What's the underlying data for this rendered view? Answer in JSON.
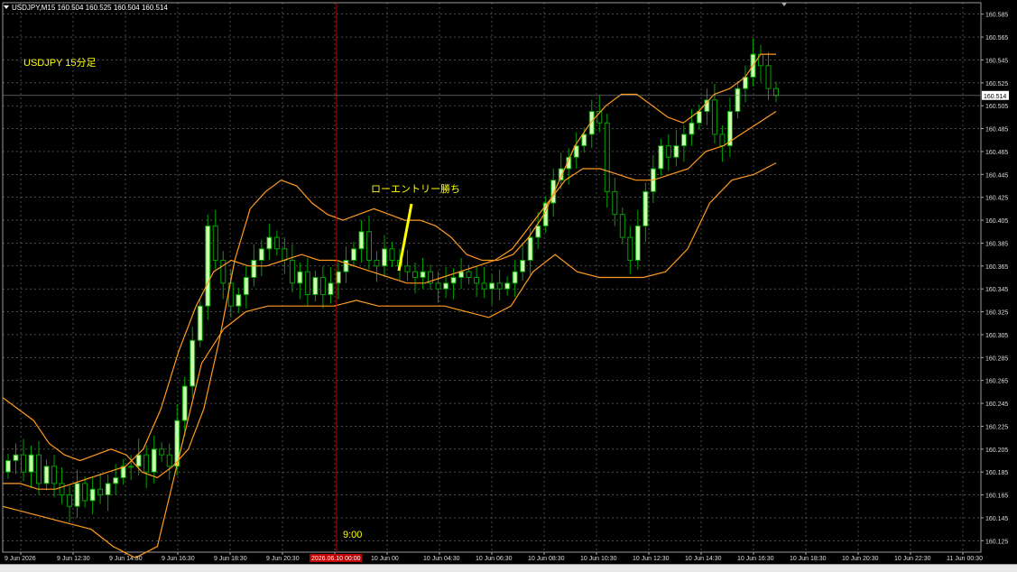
{
  "header": {
    "symbol_info": "USDJPY,M15  160.504 160.525 160.504 160.514"
  },
  "caption": "USDJPY 15分足",
  "annotation": "ローエントリー勝ち",
  "vline_label": "9:00",
  "current_price_label": "160.514",
  "highlighted_time_label": "2026.06.10 00:00",
  "colors": {
    "background": "#000000",
    "grid": "#7a7a7a",
    "candle": "#00a000",
    "candle_bull_body": "#ccffb0",
    "bands": "#ff9a1f",
    "annotation": "#ffff00",
    "vline": "#c00000"
  },
  "chart_data": {
    "type": "candlestick",
    "symbol": "USDJPY",
    "timeframe": "M15",
    "ylim": [
      160.115,
      160.6
    ],
    "y_ticks": [
      "160.585",
      "160.565",
      "160.545",
      "160.525",
      "160.505",
      "160.485",
      "160.465",
      "160.445",
      "160.425",
      "160.405",
      "160.385",
      "160.365",
      "160.345",
      "160.325",
      "160.305",
      "160.285",
      "160.265",
      "160.245",
      "160.225",
      "160.205",
      "160.185",
      "160.165",
      "160.145",
      "160.125"
    ],
    "x_ticks": [
      "9 Jun 2026",
      "9 Jun 12:30",
      "9 Jun 14:30",
      "9 Jun 16:30",
      "9 Jun 18:30",
      "9 Jun 20:30",
      "9 Jun 22:30",
      "10 Jun 00",
      "10 Jun 04:30",
      "10 Jun 06:30",
      "10 Jun 08:30",
      "10 Jun 10:30",
      "10 Jun 12:30",
      "10 Jun 14:30",
      "10 Jun 16:30",
      "10 Jun 18:30",
      "10 Jun 20:30",
      "10 Jun 22:30",
      "11 Jun 00:30"
    ],
    "series": [
      {
        "name": "close",
        "values": [
          160.195,
          160.2,
          160.185,
          160.2,
          160.175,
          160.19,
          160.175,
          160.165,
          160.155,
          160.175,
          160.16,
          160.17,
          160.165,
          160.175,
          160.18,
          160.19,
          160.19,
          160.2,
          160.185,
          160.205,
          160.2,
          160.19,
          160.23,
          160.26,
          160.3,
          160.33,
          160.4,
          160.37,
          160.35,
          160.33,
          160.34,
          160.355,
          160.37,
          160.38,
          160.39,
          160.38,
          160.37,
          160.35,
          160.36,
          160.34,
          160.355,
          160.34,
          160.35,
          160.36,
          160.37,
          160.38,
          160.395,
          160.37,
          160.365,
          160.38,
          160.37,
          160.365,
          160.36,
          160.355,
          160.36,
          160.35,
          160.345,
          160.35,
          160.355,
          160.36,
          160.355,
          160.35,
          160.345,
          160.35,
          160.345,
          160.35,
          160.36,
          160.37,
          160.39,
          160.4,
          160.42,
          160.44,
          160.45,
          160.46,
          160.47,
          160.48,
          160.5,
          160.49,
          160.43,
          160.41,
          160.39,
          160.37,
          160.4,
          160.43,
          160.45,
          160.47,
          160.46,
          160.47,
          160.48,
          160.49,
          160.5,
          160.51,
          160.48,
          160.47,
          160.5,
          160.52,
          160.53,
          160.55,
          160.54,
          160.52,
          160.514
        ]
      },
      {
        "name": "bb_upper",
        "values": [
          160.25,
          160.24,
          160.23,
          160.21,
          160.2,
          160.195,
          160.2,
          160.205,
          160.2,
          160.185,
          160.18,
          160.19,
          160.205,
          160.24,
          160.3,
          160.37,
          160.415,
          160.43,
          160.44,
          160.435,
          160.42,
          160.41,
          160.405,
          160.41,
          160.415,
          160.41,
          160.405,
          160.405,
          160.4,
          160.39,
          160.375,
          160.37,
          160.37,
          160.375,
          160.39,
          160.41,
          160.44,
          160.47,
          160.49,
          160.505,
          160.515,
          160.515,
          160.505,
          160.495,
          160.49,
          160.5,
          160.515,
          160.52,
          160.53,
          160.55,
          160.55
        ]
      },
      {
        "name": "bb_middle",
        "values": [
          160.175,
          160.175,
          160.17,
          160.17,
          160.175,
          160.18,
          160.185,
          160.19,
          160.205,
          160.24,
          160.29,
          160.33,
          160.36,
          160.37,
          160.365,
          160.365,
          160.37,
          160.375,
          160.37,
          160.37,
          160.365,
          160.36,
          160.355,
          160.35,
          160.35,
          160.355,
          160.36,
          160.365,
          160.37,
          160.38,
          160.4,
          160.42,
          160.44,
          160.45,
          160.45,
          160.445,
          160.44,
          160.44,
          160.445,
          160.45,
          160.465,
          160.47,
          160.48,
          160.49,
          160.5
        ]
      },
      {
        "name": "bb_lower",
        "values": [
          160.155,
          160.15,
          160.145,
          160.14,
          160.135,
          160.12,
          160.11,
          160.12,
          160.2,
          160.28,
          160.31,
          160.325,
          160.33,
          160.33,
          160.33,
          160.33,
          160.335,
          160.33,
          160.33,
          160.33,
          160.33,
          160.325,
          160.32,
          160.33,
          160.36,
          160.375,
          160.36,
          160.355,
          160.355,
          160.355,
          160.36,
          160.38,
          160.42,
          160.44,
          160.445,
          160.455
        ]
      }
    ]
  }
}
